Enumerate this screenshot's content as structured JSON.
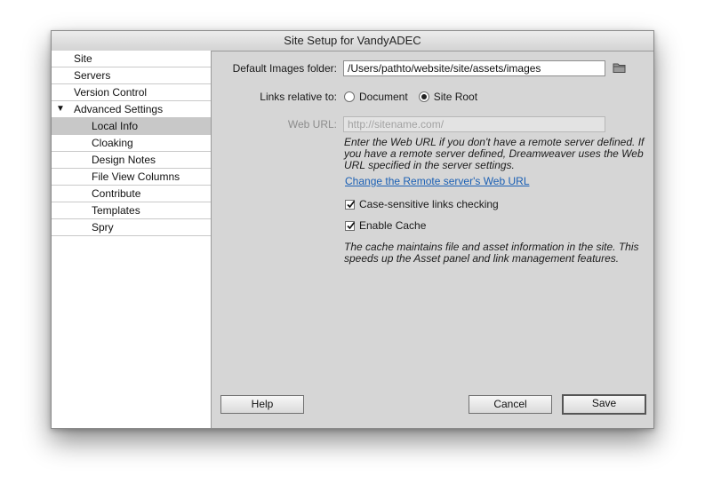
{
  "window": {
    "title": "Site Setup for VandyADEC"
  },
  "sidebar": {
    "items": [
      {
        "label": "Site"
      },
      {
        "label": "Servers"
      },
      {
        "label": "Version Control"
      },
      {
        "label": "Advanced Settings",
        "expanded": true
      },
      {
        "label": "Local Info",
        "selected": true
      },
      {
        "label": "Cloaking"
      },
      {
        "label": "Design Notes"
      },
      {
        "label": "File View Columns"
      },
      {
        "label": "Contribute"
      },
      {
        "label": "Templates"
      },
      {
        "label": "Spry"
      }
    ]
  },
  "main": {
    "images_folder": {
      "label": "Default Images folder:",
      "value": "/Users/pathto/website/site/assets/images",
      "icon": "folder-icon"
    },
    "links_relative": {
      "label": "Links relative to:",
      "options": [
        "Document",
        "Site Root"
      ],
      "selected": "Site Root"
    },
    "web_url": {
      "label": "Web URL:",
      "placeholder": "http://sitename.com/",
      "enabled": false
    },
    "web_url_note": "Enter the Web URL if you don't have a remote server defined. If you have a remote server defined, Dreamweaver uses the Web URL specified in the server settings.",
    "change_url_link": "Change the Remote server's Web URL",
    "case_sensitive": {
      "label": "Case-sensitive links checking",
      "checked": true
    },
    "enable_cache": {
      "label": "Enable Cache",
      "checked": true
    },
    "cache_note": "The cache maintains file and asset information in the site. This speeds up the Asset panel and link management features."
  },
  "buttons": {
    "help": "Help",
    "cancel": "Cancel",
    "save": "Save"
  },
  "colors": {
    "window_bg": "#d6d6d6",
    "link": "#1a5fb4",
    "selection": "#c8c8c8"
  }
}
